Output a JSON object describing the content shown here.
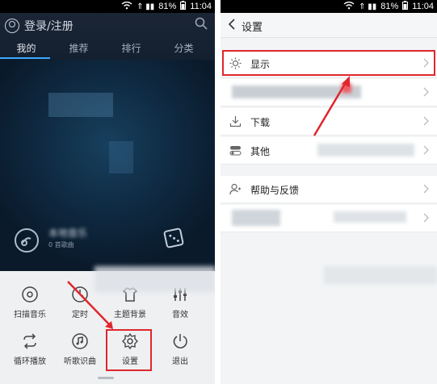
{
  "status": {
    "signal": "⇑ ▮▮",
    "battery": "81%",
    "time": "11:04"
  },
  "left": {
    "login": "登录/注册",
    "tabs": [
      "我的",
      "推荐",
      "排行",
      "分类"
    ],
    "library": {
      "title": "本地音乐",
      "count": "0 首歌曲"
    },
    "menu_row1": [
      "扫描音乐",
      "定时",
      "主题背景",
      "音效"
    ],
    "menu_row2": [
      "循环播放",
      "听歌识曲",
      "设置",
      "退出"
    ]
  },
  "right": {
    "title": "设置",
    "rows": [
      "显示",
      "",
      "下载",
      "其他",
      "帮助与反馈",
      ""
    ]
  },
  "colors": {
    "accent": "#3aa8ff",
    "highlight": "#e0262d"
  }
}
